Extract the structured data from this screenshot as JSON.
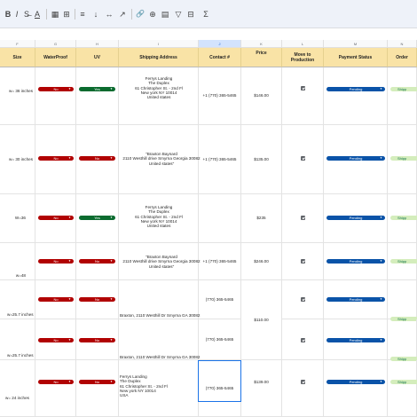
{
  "toolbar": {
    "items": [
      "B",
      "I",
      "S̶",
      "A",
      "▦",
      "⊞",
      "≡",
      "↓",
      "↔",
      "↗",
      "🔗",
      "⊕",
      "▤",
      "▽",
      "⊟",
      "Σ"
    ]
  },
  "columns": [
    "F",
    "G",
    "H",
    "I",
    "J",
    "K",
    "L",
    "M",
    "N"
  ],
  "headers": {
    "size": "Size",
    "waterproof": "WaterProof",
    "uv": "UV",
    "shipping": "Shipping Address",
    "contact": "Contact #",
    "price": "Price",
    "move": "Move to Production",
    "payment": "Payment Status",
    "order": "Order"
  },
  "rows": [
    {
      "size": "w= 36 inches",
      "wp": "No",
      "uv": "Yes",
      "addr": [
        "Ferrys Landing",
        "The Duplex",
        "61 Christopher St. - 2nd Fl",
        "New york NY 10014",
        "United states"
      ],
      "contact": "+1 (770) 365-5465",
      "price": "$146.00",
      "payment": "Pending",
      "order": "Shipp"
    },
    {
      "size": "w= 30 inches",
      "wp": "No",
      "uv": "No",
      "addr": [
        "\"Braxton Baynard",
        "2110 Westhill drive Smyrna Georgia 30082",
        "United states\""
      ],
      "contact": "+1 (770) 365-5465",
      "price": "$135.00",
      "payment": "Pending",
      "order": "Shipp"
    },
    {
      "size": "W=36",
      "wp": "No",
      "uv": "Yes",
      "addr": [
        "Ferrys Landing",
        "The Duplex",
        "61 Christopher St. - 2nd Fl",
        "New york NY 10014",
        "United states"
      ],
      "contact": "",
      "price": "$235",
      "payment": "Pending",
      "order": "Shipp"
    },
    {
      "size": "w=48",
      "wp": "No",
      "uv": "No",
      "addr": [
        "\"Braxton Baynard",
        "2110 Westhill drive Smyrna Georgia 30082",
        "United states\""
      ],
      "contact": "+1 (770) 365-5465",
      "price": "$246.00",
      "payment": "Pending",
      "order": "Shipp"
    },
    {
      "size": "w=25.7 inches",
      "wp": "No",
      "uv": "No",
      "addr": [
        "Braxton, 2110 Westhill Dr Smyrna GA 30082"
      ],
      "contact": "(770) 365-5465",
      "price": "$110.00",
      "payment": "Pending",
      "order": "Shipp"
    },
    {
      "size": "w=25.7 inches",
      "wp": "No",
      "uv": "No",
      "addr": [
        "Braxton, 2110 Westhill Dr Smyrna GA 30082"
      ],
      "contact": "(770) 365-5465",
      "price": "",
      "payment": "Pending",
      "order": "Shipp"
    },
    {
      "size": "w= 24 inches",
      "wp": "No",
      "uv": "No",
      "addr": [
        "Ferrys Landing",
        "The Duplex",
        "61 Christopher St. - 2nd Fl",
        "New york NY 10014",
        "USA"
      ],
      "contact": "(770) 365-5465",
      "price": "$139.00",
      "payment": "Pending",
      "order": "Shipp"
    }
  ],
  "colors": {
    "header_bg": "#f9e3a6",
    "no_chip": "#b10202",
    "yes_chip": "#0b6b2f",
    "pending_chip": "#0a53a8",
    "shipped_chip": "#d4edbc"
  }
}
